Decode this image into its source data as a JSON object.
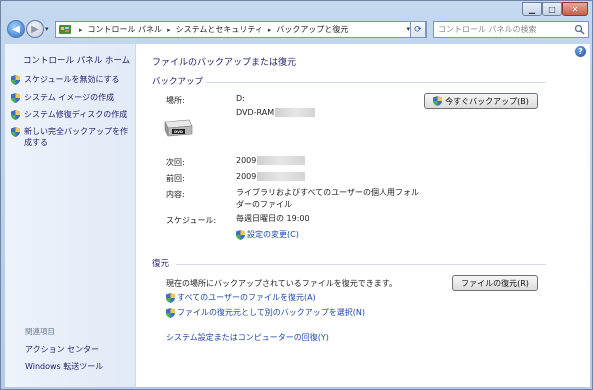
{
  "address": {
    "crumbs": [
      "コントロール パネル",
      "システムとセキュリティ",
      "バックアップと復元"
    ],
    "search_placeholder": "コントロール パネルの検索"
  },
  "sidebar": {
    "home": "コントロール パネル ホーム",
    "tasks": [
      "スケジュールを無効にする",
      "システム イメージの作成",
      "システム修復ディスクの作成",
      "新しい完全バックアップを作成する"
    ],
    "related_heading": "関連項目",
    "related_links": [
      "アクション センター",
      "Windows 転送ツール"
    ]
  },
  "main": {
    "page_heading": "ファイルのバックアップまたは復元",
    "backup": {
      "section_title": "バックアップ",
      "location_label": "場所:",
      "location_drive": "D:",
      "location_name": "DVD-RAM",
      "backup_now_button": "今すぐバックアップ(B)",
      "next_label": "次回:",
      "next_value": "2009",
      "last_label": "前回:",
      "last_value": "2009",
      "contents_label": "内容:",
      "contents_value_line1": "ライブラリおよびすべてのユーザーの個人用フォル",
      "contents_value_line2": "ダーのファイル",
      "schedule_label": "スケジュール:",
      "schedule_value": "毎週日曜日の 19:00",
      "change_settings_link": "設定の変更(C)"
    },
    "restore": {
      "section_title": "復元",
      "description": "現在の場所にバックアップされているファイルを復元できます。",
      "restore_button": "ファイルの復元(R)",
      "restore_all_users_link": "すべてのユーザーのファイルを復元(A)",
      "select_other_backup_link": "ファイルの復元元として別のバックアップを選択(N)",
      "recover_system_link": "システム設定またはコンピューターの回復(Y)"
    }
  }
}
